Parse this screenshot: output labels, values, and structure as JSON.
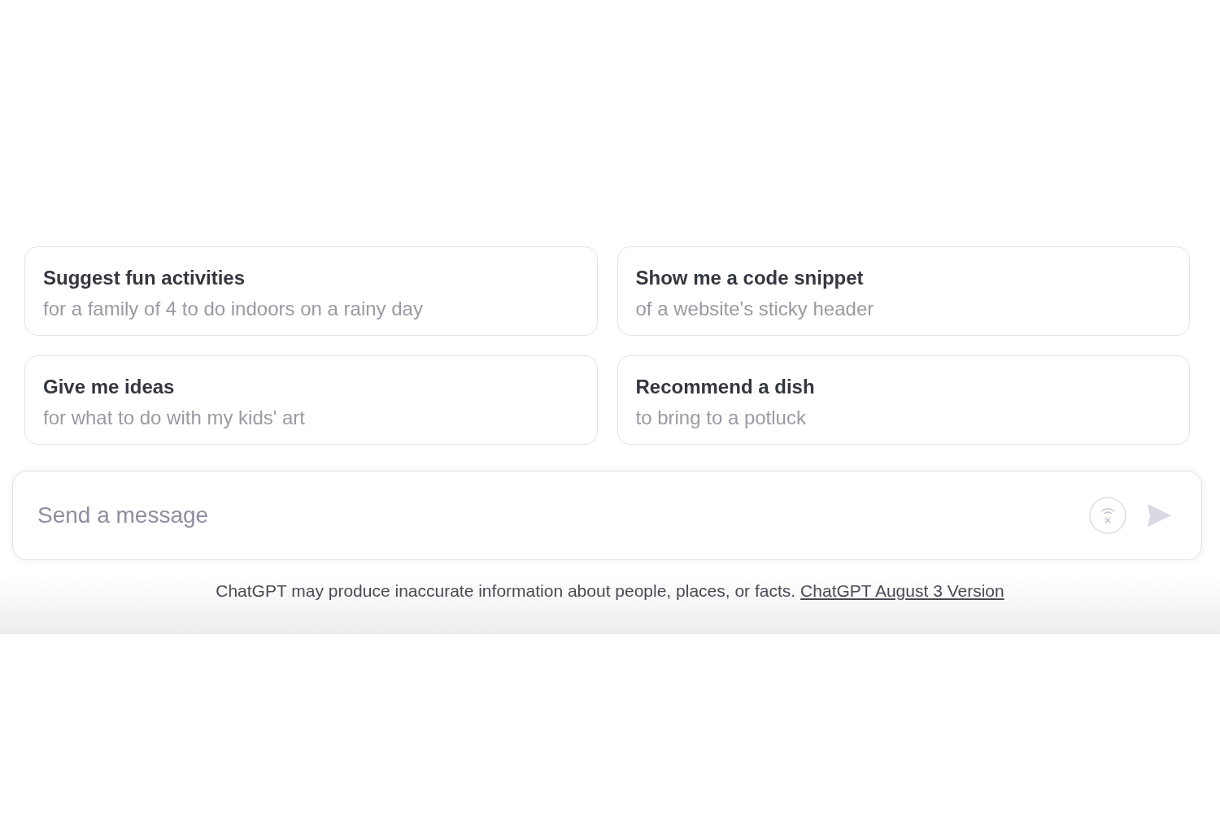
{
  "suggestions": [
    {
      "title": "Suggest fun activities",
      "subtitle": "for a family of 4 to do indoors on a rainy day"
    },
    {
      "title": "Show me a code snippet",
      "subtitle": "of a website's sticky header"
    },
    {
      "title": "Give me ideas",
      "subtitle": "for what to do with my kids' art"
    },
    {
      "title": "Recommend a dish",
      "subtitle": "to bring to a potluck"
    }
  ],
  "composer": {
    "placeholder": "Send a message"
  },
  "footer": {
    "disclaimer": "ChatGPT may produce inaccurate information about people, places, or facts.",
    "link": "ChatGPT August 3 Version"
  }
}
